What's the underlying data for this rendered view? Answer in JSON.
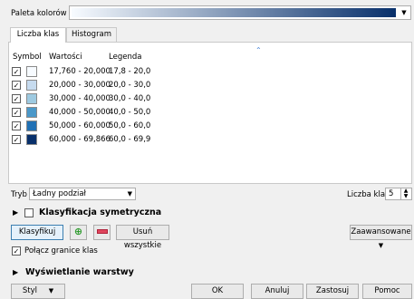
{
  "palette": {
    "label": "Paleta kolorów",
    "gradient_start": "#f7fbff",
    "gradient_end": "#08306b"
  },
  "tabs": [
    {
      "label": "Liczba klas",
      "active": true
    },
    {
      "label": "Histogram",
      "active": false
    }
  ],
  "table": {
    "headers": {
      "symbol": "Symbol",
      "values": "Wartości",
      "legend": "Legenda"
    },
    "rows": [
      {
        "checked": true,
        "color": "#f7fbff",
        "values": "17,760 - 20,000",
        "legend": "17,8 - 20,0"
      },
      {
        "checked": true,
        "color": "#c6dbef",
        "values": "20,000 - 30,000",
        "legend": "20,0 - 30,0"
      },
      {
        "checked": true,
        "color": "#9ecae1",
        "values": "30,000 - 40,000",
        "legend": "30,0 - 40,0"
      },
      {
        "checked": true,
        "color": "#4a98c9",
        "values": "40,000 - 50,000",
        "legend": "40,0 - 50,0"
      },
      {
        "checked": true,
        "color": "#2171b5",
        "values": "50,000 - 60,000",
        "legend": "50,0 - 60,0"
      },
      {
        "checked": true,
        "color": "#08306b",
        "values": "60,000 - 69,866",
        "legend": "60,0 - 69,9"
      }
    ]
  },
  "mode": {
    "label": "Tryb",
    "value": "Ładny podział"
  },
  "class_count": {
    "label": "Liczba klas",
    "value": "5"
  },
  "symmetric": {
    "label": "Klasyfikacja symetryczna",
    "checked": false
  },
  "buttons": {
    "classify": "Klasyfikuj",
    "add_icon": "plus-icon",
    "remove_icon": "minus-icon",
    "remove_all": "Usuń wszystkie",
    "advanced": "Zaawansowane"
  },
  "link_borders": {
    "label": "Połącz granice klas",
    "checked": true
  },
  "layer_rendering": {
    "label": "Wyświetlanie warstwy"
  },
  "footer": {
    "style": "Styl",
    "ok": "OK",
    "cancel": "Anuluj",
    "apply": "Zastosuj",
    "help": "Pomoc"
  }
}
